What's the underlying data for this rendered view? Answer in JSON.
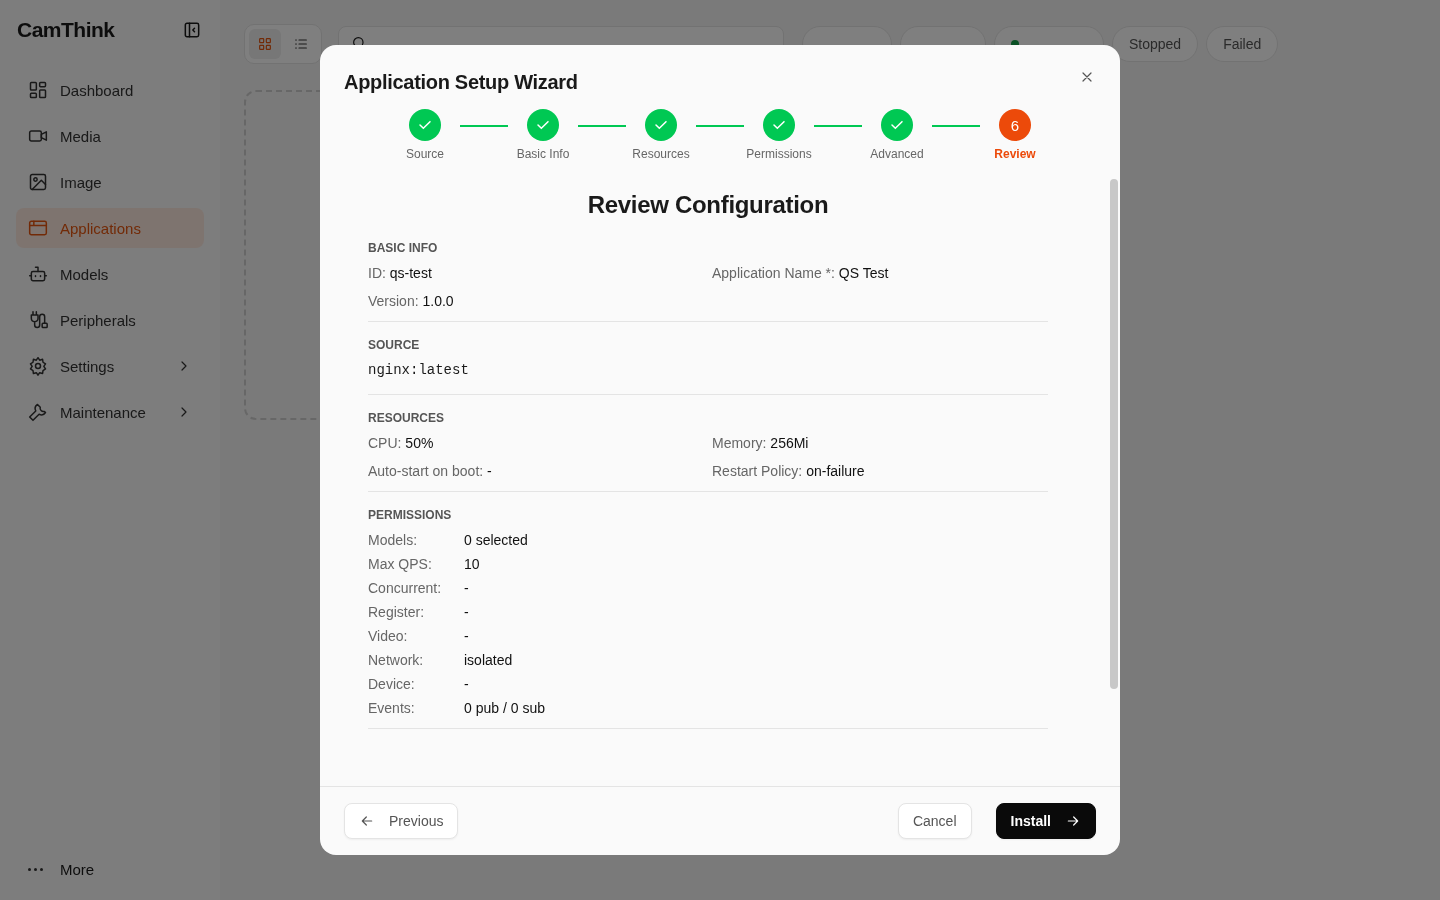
{
  "sidebar": {
    "logo": "CamThink",
    "items": [
      {
        "label": "Dashboard",
        "selected": false,
        "expandable": false
      },
      {
        "label": "Media",
        "selected": false,
        "expandable": false
      },
      {
        "label": "Image",
        "selected": false,
        "expandable": false
      },
      {
        "label": "Applications",
        "selected": true,
        "expandable": false
      },
      {
        "label": "Models",
        "selected": false,
        "expandable": false
      },
      {
        "label": "Peripherals",
        "selected": false,
        "expandable": false
      },
      {
        "label": "Settings",
        "selected": false,
        "expandable": true
      },
      {
        "label": "Maintenance",
        "selected": false,
        "expandable": true
      }
    ],
    "more": "More"
  },
  "toolbar": {
    "views": [
      {
        "kind": "grid",
        "selected": true
      },
      {
        "kind": "list",
        "selected": false
      }
    ],
    "filters": [
      {
        "label": "Stopped"
      },
      {
        "label": "Failed"
      }
    ]
  },
  "dialog": {
    "title": "Application Setup Wizard",
    "steps": [
      {
        "label": "Source",
        "done": true,
        "selected": false
      },
      {
        "label": "Basic Info",
        "done": true,
        "selected": false
      },
      {
        "label": "Resources",
        "done": true,
        "selected": false
      },
      {
        "label": "Permissions",
        "done": true,
        "selected": false
      },
      {
        "label": "Advanced",
        "done": true,
        "selected": false
      },
      {
        "label": "Review",
        "done": false,
        "selected": true,
        "number": "6"
      }
    ],
    "heading": "Review Configuration",
    "sections": [
      {
        "title": "BASIC INFO",
        "kind": "pairs",
        "fields": [
          {
            "label": "ID:",
            "value": "qs-test"
          },
          {
            "label": "Application Name *:",
            "value": "QS Test"
          },
          {
            "label": "Version:",
            "value": "1.0.0"
          }
        ]
      },
      {
        "title": "SOURCE",
        "kind": "code",
        "value": "nginx:latest"
      },
      {
        "title": "RESOURCES",
        "kind": "pairs",
        "fields": [
          {
            "label": "CPU:",
            "value": "50%"
          },
          {
            "label": "Memory:",
            "value": "256Mi"
          },
          {
            "label": "Auto-start on boot:",
            "value": "-"
          },
          {
            "label": "Restart Policy:",
            "value": "on-failure"
          }
        ]
      },
      {
        "title": "PERMISSIONS",
        "kind": "table",
        "fields": [
          {
            "label": "Models:",
            "value": "0 selected"
          },
          {
            "label": "Max QPS:",
            "value": "10"
          },
          {
            "label": "Concurrent:",
            "value": "-"
          },
          {
            "label": "Register:",
            "value": "-"
          },
          {
            "label": "Video:",
            "value": "-"
          },
          {
            "label": "Network:",
            "value": "isolated"
          },
          {
            "label": "Device:",
            "value": "-"
          },
          {
            "label": "Events:",
            "value": "0 pub / 0 sub"
          }
        ]
      }
    ],
    "previous": "Previous",
    "cancel": "Cancel",
    "install": "Install"
  }
}
